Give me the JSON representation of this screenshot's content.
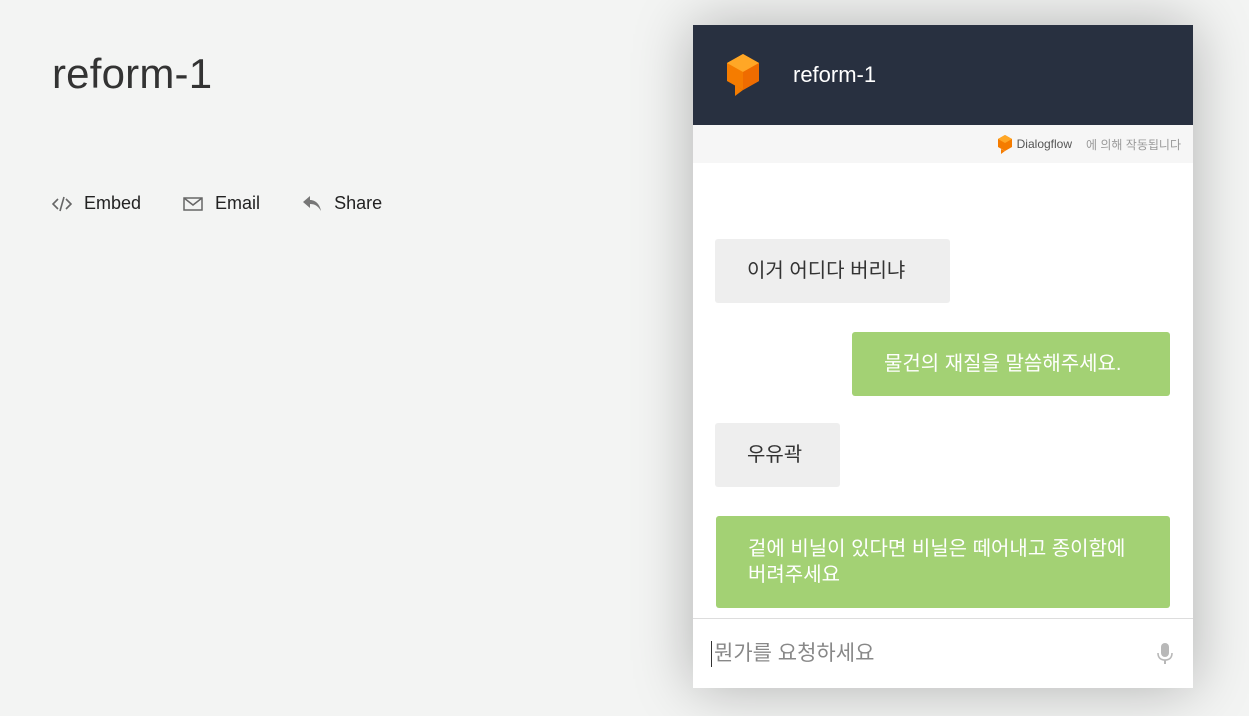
{
  "page": {
    "title": "reform-1",
    "actions": [
      {
        "label": "Embed",
        "icon": "code-icon"
      },
      {
        "label": "Email",
        "icon": "mail-icon"
      },
      {
        "label": "Share",
        "icon": "share-icon"
      }
    ]
  },
  "chat": {
    "title": "reform-1",
    "logo_icon": "dialogflow-cube-icon",
    "powered": {
      "brand": "Dialogflow",
      "text": "에 의해 작동됩니다"
    },
    "messages": [
      {
        "role": "user",
        "text": "이거 어디다 버리냐"
      },
      {
        "role": "bot",
        "text": "물건의 재질을 말씀해주세요."
      },
      {
        "role": "user",
        "text": "우유곽"
      },
      {
        "role": "bot",
        "text": "겉에 비닐이 있다면 비닐은 떼어내고 종이함에 버려주세요"
      }
    ],
    "input": {
      "placeholder": "뭔가를 요청하세요",
      "value": ""
    },
    "colors": {
      "header": "#283040",
      "bot_bubble": "#a3d174",
      "user_bubble": "#eeeeee",
      "logo": "#f57c00"
    }
  }
}
